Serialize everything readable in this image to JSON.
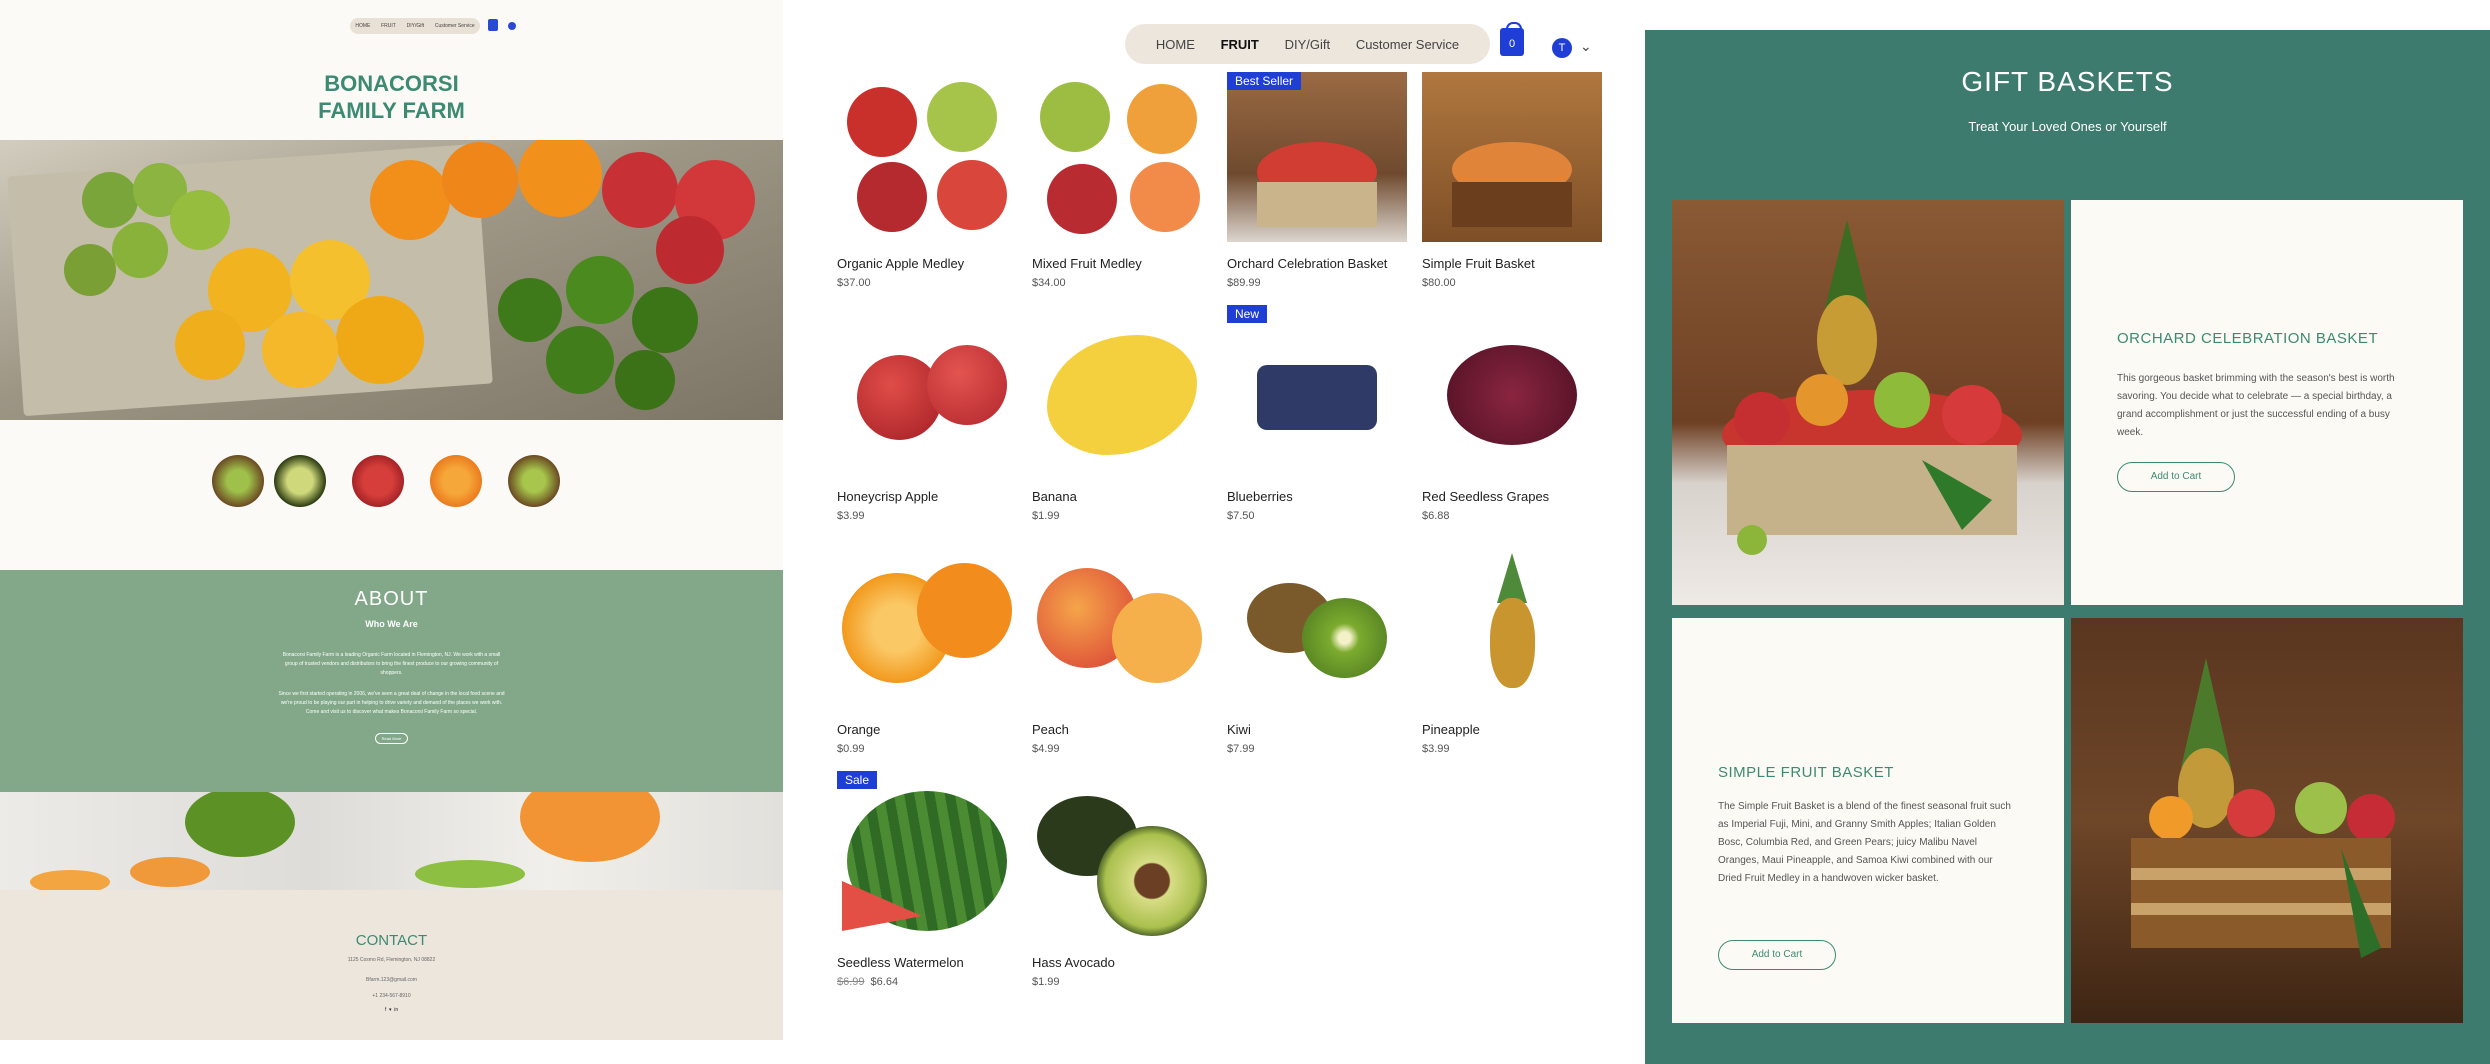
{
  "panel1": {
    "nav": [
      "HOME",
      "FRUIT",
      "DIY/Gift",
      "Customer Service"
    ],
    "brand_line1": "BONACORSI",
    "brand_line2": "FAMILY FARM",
    "about": {
      "title": "ABOUT",
      "subtitle": "Who We Are",
      "paragraph1": "Bonacorsi Family Farm is a leading Organic Farm located in Flemington, NJ. We work with a small group of trusted vendors and distributors to bring the finest produce to our growing community of shoppers.",
      "paragraph2": "Since we first started operating in 2006, we've seen a great deal of change in the local food scene and we're proud to be playing our part in helping to drive variety and demand of the places we work with. Come and visit us to discover what makes Bonacorsi Family Farm so special.",
      "button": "Read More"
    },
    "contact": {
      "title": "CONTACT",
      "address": "1125 Cosmo Rd, Flemington, NJ 08822",
      "email": "Bfarm.123@gmail.com",
      "phone": "+1 234-567-8910"
    }
  },
  "panel2": {
    "nav": {
      "items": [
        "HOME",
        "FRUIT",
        "DIY/Gift",
        "Customer Service"
      ],
      "active": "FRUIT"
    },
    "cart_count": "0",
    "avatar_letter": "T",
    "products": [
      {
        "name": "Organic Apple Medley",
        "price": "$37.00",
        "ribbon": ""
      },
      {
        "name": "Mixed Fruit Medley",
        "price": "$34.00",
        "ribbon": ""
      },
      {
        "name": "Orchard Celebration Basket",
        "price": "$89.99",
        "ribbon": "Best Seller"
      },
      {
        "name": "Simple Fruit Basket",
        "price": "$80.00",
        "ribbon": ""
      },
      {
        "name": "Honeycrisp Apple",
        "price": "$3.99",
        "ribbon": ""
      },
      {
        "name": "Banana",
        "price": "$1.99",
        "ribbon": ""
      },
      {
        "name": "Blueberries",
        "price": "$7.50",
        "ribbon": "New"
      },
      {
        "name": "Red Seedless Grapes",
        "price": "$6.88",
        "ribbon": ""
      },
      {
        "name": "Orange",
        "price": "$0.99",
        "ribbon": ""
      },
      {
        "name": "Peach",
        "price": "$4.99",
        "ribbon": ""
      },
      {
        "name": "Kiwi",
        "price": "$7.99",
        "ribbon": ""
      },
      {
        "name": "Pineapple",
        "price": "$3.99",
        "ribbon": ""
      },
      {
        "name": "Seedless Watermelon",
        "price": "$6.64",
        "old_price": "$6.99",
        "ribbon": "Sale"
      },
      {
        "name": "Hass Avocado",
        "price": "$1.99",
        "ribbon": ""
      }
    ]
  },
  "panel3": {
    "title": "GIFT BASKETS",
    "subtitle": "Treat Your Loved Ones or Yourself",
    "orchard": {
      "name": "ORCHARD CELEBRATION BASKET",
      "description": "This gorgeous basket brimming with the season's best is worth savoring. You decide what to celebrate — a special birthday, a grand accomplishment or just the successful ending of a busy week.",
      "button": "Add to Cart"
    },
    "simple": {
      "name": "SIMPLE FRUIT BASKET",
      "description": "The Simple Fruit Basket is a blend of the finest seasonal fruit such as Imperial Fuji, Mini, and Granny Smith Apples; Italian Golden Bosc, Columbia Red, and Green Pears; juicy Malibu Navel Oranges, Maui Pineapple, and Samoa Kiwi combined with our Dried Fruit Medley in a handwoven wicker basket.",
      "button": "Add to Cart"
    }
  },
  "colors": {
    "brand_green": "#3d8a73",
    "about_green": "#83a889",
    "gift_bg": "#3c7b6e",
    "accent_blue": "#1f3ed6",
    "cream": "#ece6dc"
  }
}
